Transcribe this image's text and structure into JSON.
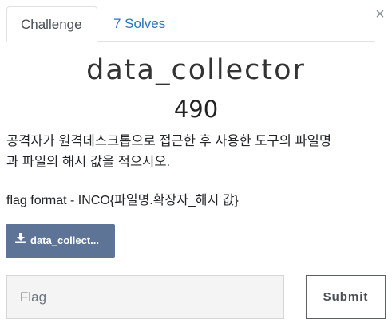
{
  "tabs": [
    {
      "label": "Challenge"
    },
    {
      "label": "7 Solves"
    }
  ],
  "close_label": "×",
  "challenge": {
    "title": "data_collector",
    "points": "490",
    "description_line1": "공격자가 원격데스크톱으로 접근한 후 사용한 도구의 파일명",
    "description_line2": "과 파일의 해시 값을 적으시오.",
    "flag_format": "flag format - INCO{파일명.확장자_해시 값}"
  },
  "download": {
    "label": "data_collect...",
    "icon": "download-icon"
  },
  "form": {
    "flag_placeholder": "Flag",
    "submit_label": "Submit"
  },
  "colors": {
    "link": "#2b73b8",
    "download_button": "#5d7496"
  }
}
